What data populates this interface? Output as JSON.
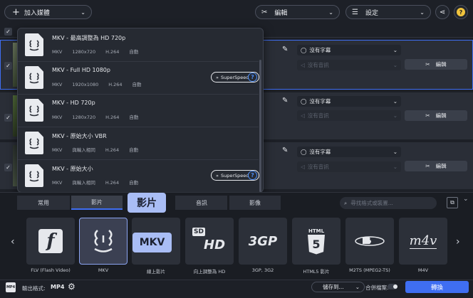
{
  "toolbar": {
    "add_media": "加入媒體",
    "edit": "編輯",
    "settings": "設定"
  },
  "rows": [
    {
      "subtitle": "沒有字幕",
      "audio": "沒有音訊",
      "edit": "編輯"
    },
    {
      "subtitle": "沒有字幕",
      "audio": "沒有音訊",
      "edit": "編輯"
    },
    {
      "subtitle": "沒有字幕",
      "audio": "沒有音訊",
      "edit": "編輯"
    }
  ],
  "format_dropdown": {
    "items": [
      {
        "title": "MKV - 最高調整為 HD 720p",
        "format": "MKV",
        "resolution": "1280x720",
        "codec": "H.264",
        "fps": "自動",
        "superspeed": false
      },
      {
        "title": "MKV - Full HD 1080p",
        "format": "MKV",
        "resolution": "1920x1080",
        "codec": "H.264",
        "fps": "自動",
        "superspeed": true
      },
      {
        "title": "MKV - HD 720p",
        "format": "MKV",
        "resolution": "1280x720",
        "codec": "H.264",
        "fps": "自動",
        "superspeed": false
      },
      {
        "title": "MKV - 原始大小 VBR",
        "format": "MKV",
        "resolution": "與輸入相同",
        "codec": "H.264",
        "fps": "自動",
        "superspeed": false
      },
      {
        "title": "MKV - 原始大小",
        "format": "MKV",
        "resolution": "與輸入相同",
        "codec": "H.264",
        "fps": "自動",
        "superspeed": true
      }
    ],
    "superspeed_label": "SuperSpeed",
    "help": "?"
  },
  "tabs": [
    "常用",
    "影片",
    "",
    "音訊",
    "影像"
  ],
  "search_placeholder": "尋找格式或裝置...",
  "tooltips": {
    "video_tab": "影片",
    "mkv": "MKV"
  },
  "format_cards": [
    {
      "label": "FLV (Flash Video)",
      "icon": "flash-icon"
    },
    {
      "label": "MKV",
      "icon": "mkv-icon"
    },
    {
      "label": "線上影片",
      "icon": "online-video-icon"
    },
    {
      "label": "向上調整為 HD",
      "icon": "sd-hd-icon"
    },
    {
      "label": "3GP, 3G2",
      "icon": "3gp-icon"
    },
    {
      "label": "HTML5 影片",
      "icon": "html5-icon"
    },
    {
      "label": "M2TS (MPEG2-TS)",
      "icon": "bluray-icon"
    },
    {
      "label": "M4V",
      "icon": "m4v-icon"
    }
  ],
  "card_text": {
    "sd": "SD",
    "hd": "HD",
    "3gp": "3GP",
    "html": "HTML",
    "html5": "5",
    "m4v": "m4v"
  },
  "footer": {
    "output_format_label": "輸出格式:",
    "output_format_value": "MP4",
    "save_to": "儲存到...",
    "merge_files": "合併檔案:",
    "convert": "轉換"
  },
  "colors": {
    "accent": "#3f6ef2",
    "tooltip": "#a9bdf5",
    "background": "#1d2027"
  }
}
